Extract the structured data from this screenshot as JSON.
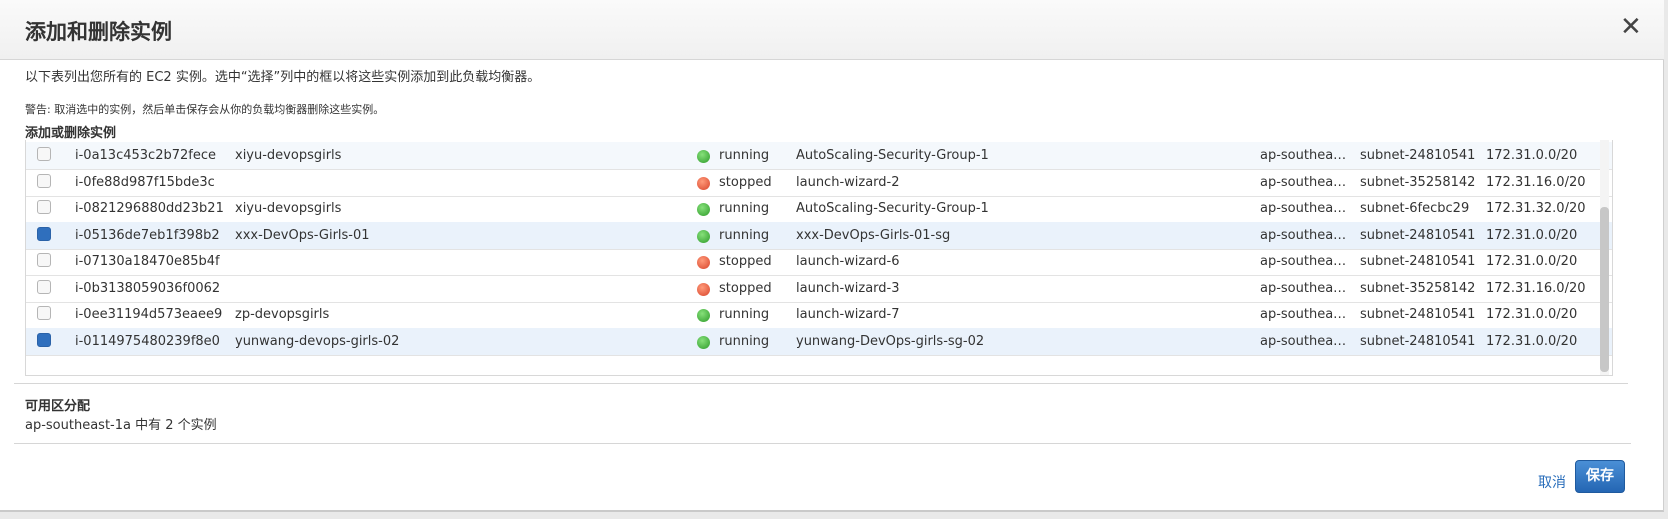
{
  "dialog": {
    "title": "添加和删除实例",
    "intro": "以下表列出您所有的 EC2 实例。选中“选择”列中的框以将这些实例添加到此负载均衡器。",
    "warning": "警告: 取消选中的实例，然后单击保存会从你的负载均衡器删除这些实例。",
    "section_title": "添加或删除实例"
  },
  "instances": [
    {
      "selected": false,
      "id": "i-0a13c453c2b72fece",
      "name": "xiyu-devopsgirls",
      "state": "running",
      "security_group": "AutoScaling-Security-Group-1",
      "az": "ap-southea…",
      "subnet": "subnet-24810541",
      "cidr": "172.31.0.0/20"
    },
    {
      "selected": false,
      "id": "i-0fe88d987f15bde3c",
      "name": "",
      "state": "stopped",
      "security_group": "launch-wizard-2",
      "az": "ap-southea…",
      "subnet": "subnet-35258142",
      "cidr": "172.31.16.0/20"
    },
    {
      "selected": false,
      "id": "i-0821296880dd23b21",
      "name": "xiyu-devopsgirls",
      "state": "running",
      "security_group": "AutoScaling-Security-Group-1",
      "az": "ap-southea…",
      "subnet": "subnet-6fecbc29",
      "cidr": "172.31.32.0/20"
    },
    {
      "selected": true,
      "id": "i-05136de7eb1f398b2",
      "name": "xxx-DevOps-Girls-01",
      "state": "running",
      "security_group": "xxx-DevOps-Girls-01-sg",
      "az": "ap-southea…",
      "subnet": "subnet-24810541",
      "cidr": "172.31.0.0/20"
    },
    {
      "selected": false,
      "id": "i-07130a18470e85b4f",
      "name": "",
      "state": "stopped",
      "security_group": "launch-wizard-6",
      "az": "ap-southea…",
      "subnet": "subnet-24810541",
      "cidr": "172.31.0.0/20"
    },
    {
      "selected": false,
      "id": "i-0b3138059036f0062",
      "name": "",
      "state": "stopped",
      "security_group": "launch-wizard-3",
      "az": "ap-southea…",
      "subnet": "subnet-35258142",
      "cidr": "172.31.16.0/20"
    },
    {
      "selected": false,
      "id": "i-0ee31194d573eaee9",
      "name": "zp-devopsgirls",
      "state": "running",
      "security_group": "launch-wizard-7",
      "az": "ap-southea…",
      "subnet": "subnet-24810541",
      "cidr": "172.31.0.0/20"
    },
    {
      "selected": true,
      "id": "i-0114975480239f8e0",
      "name": "yunwang-devops-girls-02",
      "state": "running",
      "security_group": "yunwang-DevOps-girls-sg-02",
      "az": "ap-southea…",
      "subnet": "subnet-24810541",
      "cidr": "172.31.0.0/20"
    }
  ],
  "az_distribution": {
    "title": "可用区分配",
    "text": "ap-southeast-1a 中有 2 个实例"
  },
  "footer": {
    "cancel_label": "取消",
    "save_label": "保存"
  },
  "colors": {
    "running": "#3aa935",
    "stopped": "#e4502f",
    "primary": "#2a6ebb"
  },
  "icons": {
    "close": "close-icon",
    "state": "status-dot-icon"
  }
}
